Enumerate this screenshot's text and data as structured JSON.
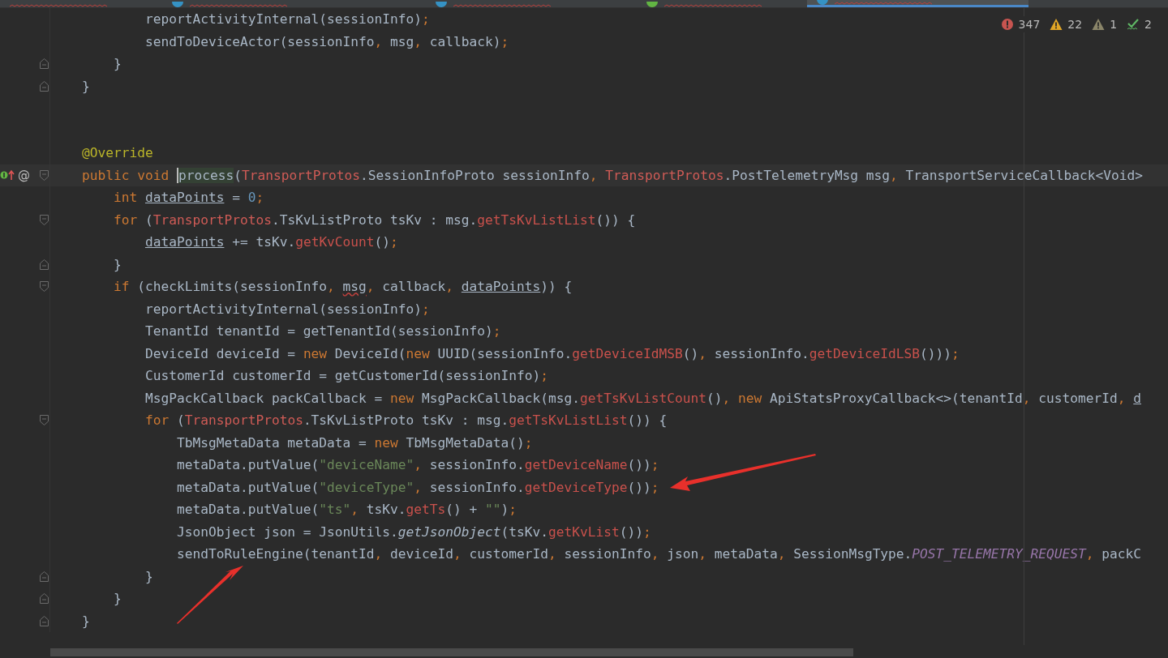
{
  "tabs": [
    {
      "selected": false
    },
    {
      "selected": false,
      "color": "#3592c4"
    },
    {
      "selected": false,
      "color": "#3592c4"
    },
    {
      "selected": false,
      "color": "#62b543"
    },
    {
      "selected": true,
      "color": "#3592c4"
    }
  ],
  "inspections": [
    {
      "kind": "error",
      "count": "347"
    },
    {
      "kind": "warning",
      "count": "22"
    },
    {
      "kind": "weak",
      "count": "1"
    },
    {
      "kind": "typo",
      "count": "2"
    }
  ],
  "lines": [
    {
      "kind": "code",
      "tokens": [
        {
          "kind": "p",
          "text": "            reportActivityInternal(sessionInfo)"
        },
        {
          "kind": "o",
          "text": ";"
        }
      ]
    },
    {
      "kind": "code",
      "tokens": [
        {
          "kind": "p",
          "text": "            sendToDeviceActor(sessionInfo"
        },
        {
          "kind": "o",
          "text": ", "
        },
        {
          "kind": "p",
          "text": "msg"
        },
        {
          "kind": "o",
          "text": ", "
        },
        {
          "kind": "p",
          "text": "callback)"
        },
        {
          "kind": "o",
          "text": ";"
        }
      ]
    },
    {
      "kind": "code",
      "fold": {
        "kind": "close"
      },
      "tokens": [
        {
          "kind": "p",
          "text": "        }"
        }
      ]
    },
    {
      "kind": "code",
      "fold": {
        "kind": "close"
      },
      "tokens": [
        {
          "kind": "p",
          "text": "    }"
        }
      ]
    },
    {
      "kind": "blank"
    },
    {
      "kind": "blank"
    },
    {
      "kind": "code",
      "tokens": [
        {
          "kind": "a",
          "text": "    @Override"
        }
      ]
    },
    {
      "kind": "code",
      "current": true,
      "fold": {
        "kind": "open"
      },
      "marks": [
        {
          "kind": "implements"
        },
        {
          "kind": "annotation",
          "symbol": "@"
        }
      ],
      "tokens": [
        {
          "kind": "k",
          "text": "    public void "
        },
        {
          "kind": "h",
          "text": "process"
        },
        {
          "kind": "p",
          "text": "("
        },
        {
          "kind": "t",
          "text": "TransportProtos"
        },
        {
          "kind": "p",
          "text": ".SessionInfoProto sessionInfo"
        },
        {
          "kind": "o",
          "text": ", "
        },
        {
          "kind": "t",
          "text": "TransportProtos"
        },
        {
          "kind": "p",
          "text": ".PostTelemetryMsg msg"
        },
        {
          "kind": "o",
          "text": ", "
        },
        {
          "kind": "p",
          "text": "TransportServiceCallback<Void>"
        }
      ]
    },
    {
      "kind": "code",
      "tokens": [
        {
          "kind": "k",
          "text": "        int "
        },
        {
          "kind": "u",
          "text": "dataPoints"
        },
        {
          "kind": "p",
          "text": " = "
        },
        {
          "kind": "n",
          "text": "0"
        },
        {
          "kind": "o",
          "text": ";"
        }
      ]
    },
    {
      "kind": "code",
      "fold": {
        "kind": "open"
      },
      "tokens": [
        {
          "kind": "k",
          "text": "        for "
        },
        {
          "kind": "p",
          "text": "("
        },
        {
          "kind": "t",
          "text": "TransportProtos"
        },
        {
          "kind": "p",
          "text": ".TsKvListProto tsKv : msg."
        },
        {
          "kind": "c",
          "text": "getTsKvListList"
        },
        {
          "kind": "p",
          "text": "()) {"
        }
      ]
    },
    {
      "kind": "code",
      "tokens": [
        {
          "kind": "u",
          "text": "            dataPoints"
        },
        {
          "kind": "p",
          "text": " += tsKv."
        },
        {
          "kind": "c",
          "text": "getKvCount"
        },
        {
          "kind": "p",
          "text": "()"
        },
        {
          "kind": "o",
          "text": ";"
        }
      ]
    },
    {
      "kind": "code",
      "fold": {
        "kind": "close"
      },
      "tokens": [
        {
          "kind": "p",
          "text": "        }"
        }
      ]
    },
    {
      "kind": "code",
      "fold": {
        "kind": "open"
      },
      "tokens": [
        {
          "kind": "k",
          "text": "        if "
        },
        {
          "kind": "p",
          "text": "(checkLimits(sessionInfo"
        },
        {
          "kind": "o",
          "text": ", "
        },
        {
          "kind": "e",
          "text": "msg"
        },
        {
          "kind": "o",
          "text": ", "
        },
        {
          "kind": "p",
          "text": "callback"
        },
        {
          "kind": "o",
          "text": ", "
        },
        {
          "kind": "u",
          "text": "dataPoints"
        },
        {
          "kind": "p",
          "text": ")) {"
        }
      ]
    },
    {
      "kind": "code",
      "tokens": [
        {
          "kind": "p",
          "text": "            reportActivityInternal(sessionInfo)"
        },
        {
          "kind": "o",
          "text": ";"
        }
      ]
    },
    {
      "kind": "code",
      "tokens": [
        {
          "kind": "p",
          "text": "            TenantId tenantId = getTenantId(sessionInfo)"
        },
        {
          "kind": "o",
          "text": ";"
        }
      ]
    },
    {
      "kind": "code",
      "tokens": [
        {
          "kind": "p",
          "text": "            DeviceId deviceId = "
        },
        {
          "kind": "k",
          "text": "new "
        },
        {
          "kind": "p",
          "text": "DeviceId("
        },
        {
          "kind": "k",
          "text": "new "
        },
        {
          "kind": "p",
          "text": "UUID(sessionInfo."
        },
        {
          "kind": "c",
          "text": "getDeviceIdMSB"
        },
        {
          "kind": "p",
          "text": "()"
        },
        {
          "kind": "o",
          "text": ", "
        },
        {
          "kind": "p",
          "text": "sessionInfo."
        },
        {
          "kind": "c",
          "text": "getDeviceIdLSB"
        },
        {
          "kind": "p",
          "text": "()))"
        },
        {
          "kind": "o",
          "text": ";"
        }
      ]
    },
    {
      "kind": "code",
      "tokens": [
        {
          "kind": "p",
          "text": "            CustomerId customerId = getCustomerId(sessionInfo)"
        },
        {
          "kind": "o",
          "text": ";"
        }
      ]
    },
    {
      "kind": "code",
      "tokens": [
        {
          "kind": "p",
          "text": "            MsgPackCallback packCallback = "
        },
        {
          "kind": "k",
          "text": "new "
        },
        {
          "kind": "p",
          "text": "MsgPackCallback(msg."
        },
        {
          "kind": "c",
          "text": "getTsKvListCount"
        },
        {
          "kind": "p",
          "text": "()"
        },
        {
          "kind": "o",
          "text": ", "
        },
        {
          "kind": "k",
          "text": "new "
        },
        {
          "kind": "p",
          "text": "ApiStatsProxyCallback<>(tenantId"
        },
        {
          "kind": "o",
          "text": ", "
        },
        {
          "kind": "p",
          "text": "customerId"
        },
        {
          "kind": "o",
          "text": ", "
        },
        {
          "kind": "u",
          "text": "d"
        }
      ]
    },
    {
      "kind": "code",
      "fold": {
        "kind": "open"
      },
      "tokens": [
        {
          "kind": "k",
          "text": "            for "
        },
        {
          "kind": "p",
          "text": "("
        },
        {
          "kind": "t",
          "text": "TransportProtos"
        },
        {
          "kind": "p",
          "text": ".TsKvListProto tsKv : msg."
        },
        {
          "kind": "c",
          "text": "getTsKvListList"
        },
        {
          "kind": "p",
          "text": "()) {"
        }
      ]
    },
    {
      "kind": "code",
      "tokens": [
        {
          "kind": "p",
          "text": "                TbMsgMetaData metaData = "
        },
        {
          "kind": "k",
          "text": "new "
        },
        {
          "kind": "p",
          "text": "TbMsgMetaData()"
        },
        {
          "kind": "o",
          "text": ";"
        }
      ]
    },
    {
      "kind": "code",
      "tokens": [
        {
          "kind": "p",
          "text": "                metaData.putValue("
        },
        {
          "kind": "s",
          "text": "\"deviceName\""
        },
        {
          "kind": "o",
          "text": ", "
        },
        {
          "kind": "p",
          "text": "sessionInfo."
        },
        {
          "kind": "c",
          "text": "getDeviceName"
        },
        {
          "kind": "p",
          "text": "())"
        },
        {
          "kind": "o",
          "text": ";"
        }
      ]
    },
    {
      "kind": "code",
      "tokens": [
        {
          "kind": "p",
          "text": "                metaData.putValue("
        },
        {
          "kind": "s",
          "text": "\"deviceType\""
        },
        {
          "kind": "o",
          "text": ", "
        },
        {
          "kind": "p",
          "text": "sessionInfo."
        },
        {
          "kind": "c",
          "text": "getDeviceType"
        },
        {
          "kind": "p",
          "text": "())"
        },
        {
          "kind": "o",
          "text": ";"
        }
      ]
    },
    {
      "kind": "code",
      "tokens": [
        {
          "kind": "p",
          "text": "                metaData.putValue("
        },
        {
          "kind": "s",
          "text": "\"ts\""
        },
        {
          "kind": "o",
          "text": ", "
        },
        {
          "kind": "p",
          "text": "tsKv."
        },
        {
          "kind": "c",
          "text": "getTs"
        },
        {
          "kind": "p",
          "text": "() + "
        },
        {
          "kind": "s",
          "text": "\"\""
        },
        {
          "kind": "p",
          "text": ")"
        },
        {
          "kind": "o",
          "text": ";"
        }
      ]
    },
    {
      "kind": "code",
      "tokens": [
        {
          "kind": "p",
          "text": "                JsonObject json = JsonUtils."
        },
        {
          "kind": "st",
          "text": "getJsonObject"
        },
        {
          "kind": "p",
          "text": "(tsKv."
        },
        {
          "kind": "c",
          "text": "getKvList"
        },
        {
          "kind": "p",
          "text": "())"
        },
        {
          "kind": "o",
          "text": ";"
        }
      ]
    },
    {
      "kind": "code",
      "tokens": [
        {
          "kind": "p",
          "text": "                sendToRuleEngine(tenantId"
        },
        {
          "kind": "o",
          "text": ", "
        },
        {
          "kind": "p",
          "text": "deviceId"
        },
        {
          "kind": "o",
          "text": ", "
        },
        {
          "kind": "p",
          "text": "customerId"
        },
        {
          "kind": "o",
          "text": ", "
        },
        {
          "kind": "p",
          "text": "sessionInfo"
        },
        {
          "kind": "o",
          "text": ", "
        },
        {
          "kind": "p",
          "text": "json"
        },
        {
          "kind": "o",
          "text": ", "
        },
        {
          "kind": "p",
          "text": "metaData"
        },
        {
          "kind": "o",
          "text": ", "
        },
        {
          "kind": "p",
          "text": "SessionMsgType."
        },
        {
          "kind": "i",
          "text": "POST_TELEMETRY_REQUEST"
        },
        {
          "kind": "o",
          "text": ", "
        },
        {
          "kind": "p",
          "text": "packC"
        }
      ]
    },
    {
      "kind": "code",
      "fold": {
        "kind": "close"
      },
      "tokens": [
        {
          "kind": "p",
          "text": "            }"
        }
      ]
    },
    {
      "kind": "code",
      "fold": {
        "kind": "close"
      },
      "tokens": [
        {
          "kind": "p",
          "text": "        }"
        }
      ]
    },
    {
      "kind": "code",
      "fold": {
        "kind": "close"
      },
      "tokens": [
        {
          "kind": "p",
          "text": "    }"
        }
      ]
    }
  ]
}
